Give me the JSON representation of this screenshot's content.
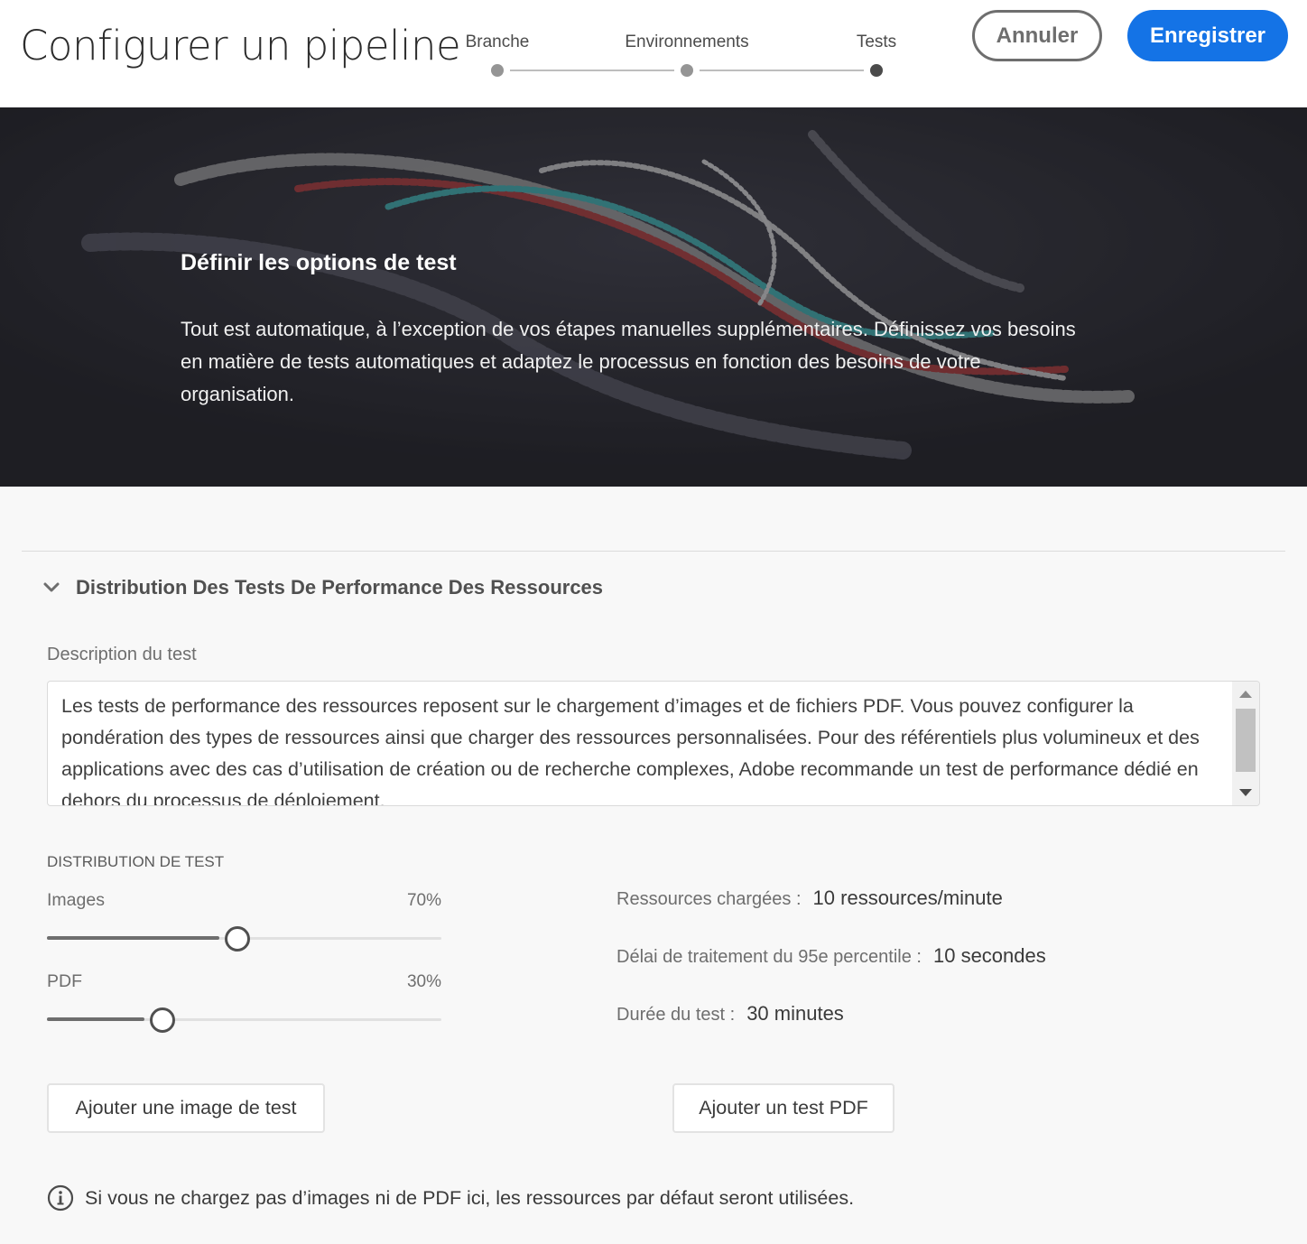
{
  "header": {
    "title": "Configurer un pipeline",
    "steps": [
      {
        "label": "Branche",
        "state": "completed"
      },
      {
        "label": "Environnements",
        "state": "completed"
      },
      {
        "label": "Tests",
        "state": "active"
      }
    ],
    "cancel_label": "Annuler",
    "save_label": "Enregistrer"
  },
  "hero": {
    "title": "Définir les options de test",
    "text": "Tout est automatique, à l’exception de vos étapes manuelles supplémentaires. Définissez vos besoins en matière de tests automatiques et adaptez le processus en fonction des besoins de votre organisation."
  },
  "section": {
    "title": "Distribution Des Tests De Performance Des Ressources",
    "description_label": "Description du test",
    "description_text": "Les tests de performance des ressources reposent sur le chargement d’images et de fichiers PDF. Vous pouvez configurer la pondération des types de ressources ainsi que charger des ressources personnalisées. Pour des référentiels plus volumineux et des applications avec des cas d’utilisation de création ou de recherche complexes, Adobe recommande un test de performance dédié en dehors du processus de déploiement."
  },
  "distribution": {
    "title": "DISTRIBUTION DE TEST",
    "images": {
      "label": "Images",
      "value_text": "70%",
      "value": 0.7
    },
    "pdf": {
      "label": "PDF",
      "value_text": "30%",
      "value": 0.3
    }
  },
  "stats": {
    "loaded_label": "Ressources chargées :",
    "loaded_value": "10 ressources/minute",
    "delay_label": "Délai de traitement du 95e percentile :",
    "delay_value": "10 secondes",
    "duration_label": "Durée du test :",
    "duration_value": "30 minutes"
  },
  "actions": {
    "add_image_label": "Ajouter une image de test",
    "add_pdf_label": "Ajouter un test PDF"
  },
  "info": {
    "icon": "info-icon",
    "text": "Si vous ne chargez pas d’images ni de PDF ici, les ressources par défaut seront utilisées."
  },
  "colors": {
    "accent": "#1473e6",
    "hero_bg": "#25252b"
  }
}
